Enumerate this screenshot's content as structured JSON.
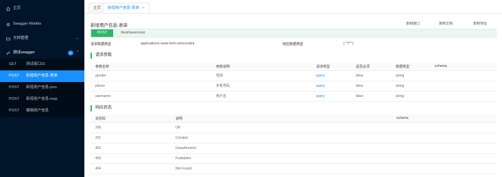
{
  "sidebar": {
    "items": [
      {
        "label": "主页",
        "icon": "home-icon"
      },
      {
        "label": "Swagger Models",
        "icon": "gear-icon"
      },
      {
        "label": "文档管理",
        "icon": "folder-icon"
      },
      {
        "label": "测试swagger",
        "icon": "link-icon",
        "badge": "5"
      }
    ],
    "apis": [
      {
        "method": "GET",
        "label": "测试接口01"
      },
      {
        "method": "POST",
        "label": "新增用户信息-表单"
      },
      {
        "method": "POST",
        "label": "新增用户信息-json"
      },
      {
        "method": "POST",
        "label": "新增用户信息-map"
      },
      {
        "method": "POST",
        "label": "编辑用户信息"
      }
    ]
  },
  "tabs": [
    {
      "label": "主页"
    },
    {
      "label": "新增用户信息-表单",
      "close": "×"
    }
  ],
  "api": {
    "title": "新增用户信息-表单",
    "copy_api": "复制接口",
    "copy_doc": "复制文档",
    "copy_url": "复制地址",
    "method": "POST",
    "path": "/test/save/user",
    "request_type_label": "请求数据类型",
    "request_type": "application/x-www-form-urlencoded",
    "response_type_label": "响应数据类型",
    "response_type": "[ \"*/*\" ]"
  },
  "params": {
    "heading": "请求参数",
    "columns": [
      "参数名称",
      "参数说明",
      "请求类型",
      "是否必须",
      "数据类型",
      "schema"
    ],
    "rows": [
      [
        "gender",
        "性别",
        "query",
        "false",
        "string",
        ""
      ],
      [
        "phone",
        "手机号码",
        "query",
        "false",
        "string",
        ""
      ],
      [
        "username",
        "用户名",
        "query",
        "false",
        "string",
        ""
      ]
    ]
  },
  "responses": {
    "heading": "响应状态",
    "columns": [
      "状态码",
      "说明",
      "schema"
    ],
    "rows": [
      [
        "200",
        "OK",
        ""
      ],
      [
        "201",
        "Created",
        ""
      ],
      [
        "401",
        "Unauthorized",
        ""
      ],
      [
        "403",
        "Forbidden",
        ""
      ],
      [
        "404",
        "Not Found",
        ""
      ]
    ]
  },
  "colors": {
    "sidebar_bg": "#001529",
    "active": "#1890ff",
    "post": "#2db769"
  }
}
